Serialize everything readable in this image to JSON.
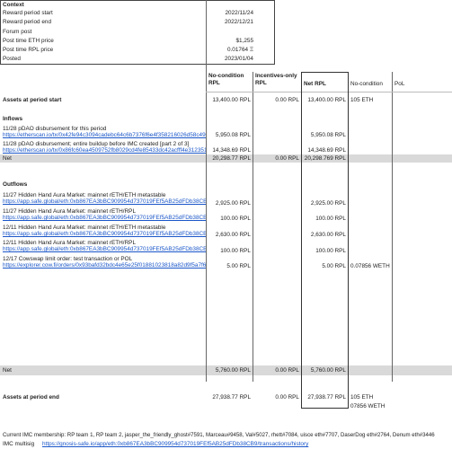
{
  "context": {
    "title": "Context",
    "rows": [
      {
        "label": "Reward period start",
        "value": "2022/11/24"
      },
      {
        "label": "Reward period end",
        "value": "2022/12/21"
      },
      {
        "label": "Forum post",
        "value": ""
      },
      {
        "label": "Post time ETH price",
        "value": "$1,255"
      },
      {
        "label": "Post time RPL price",
        "value": "0.01764 Ξ"
      },
      {
        "label": "Posted",
        "value": "2023/01/04"
      }
    ]
  },
  "headers": {
    "no_condition": "No-condition RPL",
    "incentives_only": "Incentives-only RPL",
    "net_rpl": "Net RPL",
    "no_condition_2": "No-condition",
    "pol": "PoL"
  },
  "assets_start": {
    "label": "Assets at period start",
    "no_condition": "13,400.00 RPL",
    "incentives": "0.00 RPL",
    "net": "13,400.00 RPL",
    "extra": "105 ETH"
  },
  "inflows": {
    "title": "Inflows",
    "items": [
      {
        "desc": "11/28 pDAO disbursement for this period",
        "link": "https://etherscan.io/tx/0x42fe94c3094cadebc64c6b7376f6e4f358216026d58c490f",
        "no_condition": "5,950.08 RPL",
        "net": "5,950.08 RPL"
      },
      {
        "desc": "11/28 pDAO disbursement; entire buildup before IMC created [part 2 of 3]",
        "link": "https://etherscan.io/tx/0x86fc60ea4509752fb8029cd4fe85433dc42acfff4e312351",
        "no_condition": "14,348.69 RPL",
        "net": "14,348.69 RPL"
      }
    ],
    "net": {
      "label": "Net",
      "no_condition": "20,298.77 RPL",
      "incentives": "0.00 RPL",
      "net": "20,298.769 RPL"
    }
  },
  "outflows": {
    "title": "Outflows",
    "items": [
      {
        "desc": "11/27 Hidden Hand Aura Market: mainnet rETH/ETH metastable",
        "link": "https://app.safe.global/eth:0xb867EA3bBC909954d737019FEf5AB25dFDb38CB9",
        "no_condition": "2,925.00 RPL",
        "net": "2,925.00 RPL",
        "extra": ""
      },
      {
        "desc": "11/27 Hidden Hand Aura Market: mainnet rETH/RPL",
        "link": "https://app.safe.global/eth:0xb867EA3bBC909954d737019FEf5AB25dFDb38CB9",
        "no_condition": "100.00 RPL",
        "net": "100.00 RPL",
        "extra": ""
      },
      {
        "desc": "12/11 Hidden Hand Aura Market: mainnet rETH/ETH metastable",
        "link": "https://app.safe.global/eth:0xb867EA3bBC909954d737019FEf5AB25dFDb38CB9",
        "no_condition": "2,630.00 RPL",
        "net": "2,630.00 RPL",
        "extra": ""
      },
      {
        "desc": "12/11 Hidden Hand Aura Market: mainnet rETH/RPL",
        "link": "https://app.safe.global/eth:0xb867EA3bBC909954d737019FEf5AB25dFDb38CB9",
        "no_condition": "100.00 RPL",
        "net": "100.00 RPL",
        "extra": ""
      },
      {
        "desc": "12/17 Cowswap limit order: test transaction or POL",
        "link": "https://explorer.cow.fi/orders/0x93bafd32bdc4e65e25f01881023818a82d9f5a7f6b",
        "no_condition": "5.00 RPL",
        "net": "5.00 RPL",
        "extra": "0.07856 WETH"
      }
    ],
    "net": {
      "label": "Net",
      "no_condition": "5,760.00 RPL",
      "incentives": "0.00 RPL",
      "net": "5,760.00 RPL"
    }
  },
  "assets_end": {
    "label": "Assets at period end",
    "no_condition": "27,938.77 RPL",
    "incentives": "0.00 RPL",
    "net": "27,938.77 RPL",
    "extra1": "105 ETH",
    "extra2": "07856 WETH"
  },
  "footer": {
    "membership": "Current IMC membership: RP team 1, RP team 2, jasper_the_friendly_ghost#7591, Marceau#9458, Val#5027, rhett#7084, uisce eth#7707, DaserDog eth#2764, Denum eth#3446",
    "multisig_label": "IMC multisig",
    "multisig_link": "https://gnosis-safe.io/app/eth:0xb867EA3bBC909954d737019FEf5AB25dFDb38CB9/transactions/history"
  }
}
